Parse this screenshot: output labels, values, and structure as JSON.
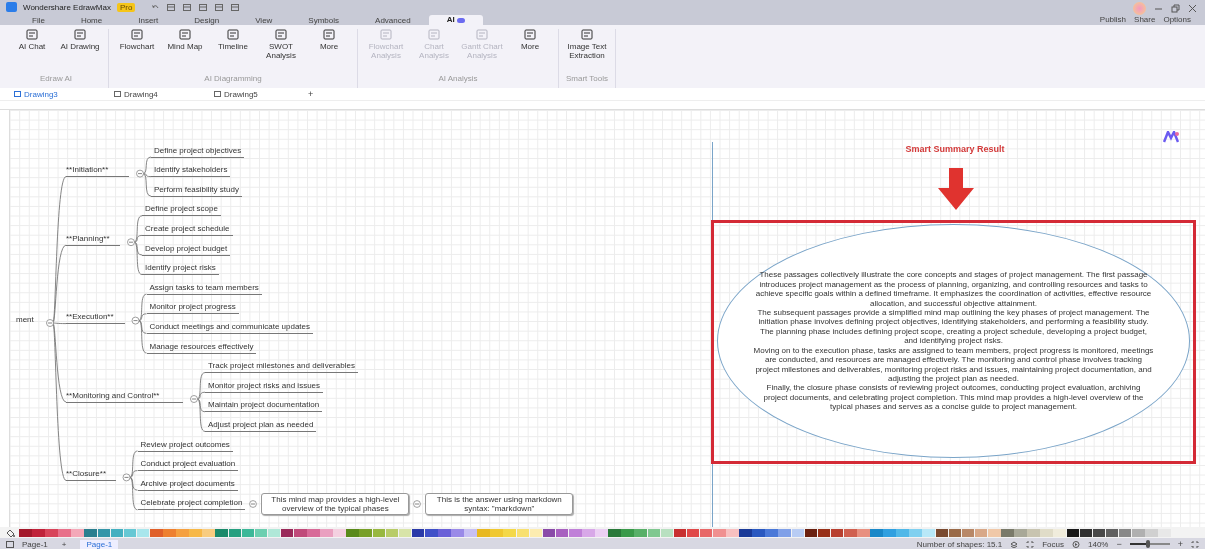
{
  "app": {
    "title": "Wondershare EdrawMax",
    "badge": "Pro"
  },
  "menu_tabs": [
    {
      "label": "File",
      "selected": false
    },
    {
      "label": "Home",
      "selected": false
    },
    {
      "label": "Insert",
      "selected": false
    },
    {
      "label": "Design",
      "selected": false
    },
    {
      "label": "View",
      "selected": false
    },
    {
      "label": "Symbols",
      "selected": false
    },
    {
      "label": "Advanced",
      "selected": false
    },
    {
      "label": "AI",
      "selected": true
    }
  ],
  "account_actions": [
    "Publish",
    "Share",
    "Options"
  ],
  "ribbon_groups": [
    {
      "title": "Edraw AI",
      "buttons": [
        {
          "label": "AI Chat",
          "disabled": false
        },
        {
          "label": "AI Drawing",
          "disabled": false
        }
      ]
    },
    {
      "title": "AI Diagramming",
      "buttons": [
        {
          "label": "Flowchart",
          "disabled": false
        },
        {
          "label": "Mind Map",
          "disabled": false
        },
        {
          "label": "Timeline",
          "disabled": false
        },
        {
          "label": "SWOT Analysis",
          "disabled": false
        },
        {
          "label": "More",
          "disabled": false
        }
      ]
    },
    {
      "title": "AI Analysis",
      "buttons": [
        {
          "label": "Flowchart Analysis",
          "disabled": true
        },
        {
          "label": "Chart Analysis",
          "disabled": true
        },
        {
          "label": "Gantt Chart Analysis",
          "disabled": true
        },
        {
          "label": "More",
          "disabled": false
        }
      ]
    },
    {
      "title": "Smart Tools",
      "buttons": [
        {
          "label": "Image Text Extraction",
          "disabled": false
        }
      ]
    }
  ],
  "document_tabs": [
    {
      "label": "Drawing3",
      "selected": true
    },
    {
      "label": "Drawing4",
      "selected": false
    },
    {
      "label": "Drawing5",
      "selected": false
    }
  ],
  "add_tab": "+",
  "mind_map": {
    "label": "ment",
    "children": [
      {
        "label": "**Initiation**",
        "children": [
          {
            "label": "Define project objectives"
          },
          {
            "label": "Identify stakeholders"
          },
          {
            "label": "Perform feasibility study"
          }
        ]
      },
      {
        "label": "**Planning**",
        "children": [
          {
            "label": "Define project scope"
          },
          {
            "label": "Create project schedule"
          },
          {
            "label": "Develop project budget"
          },
          {
            "label": "Identify project risks"
          }
        ]
      },
      {
        "label": "**Execution**",
        "children": [
          {
            "label": "Assign tasks to team members"
          },
          {
            "label": "Monitor project progress"
          },
          {
            "label": "Conduct meetings and communicate updates"
          },
          {
            "label": "Manage resources effectively"
          }
        ]
      },
      {
        "label": "**Monitoring and Control**",
        "children": [
          {
            "label": "Track project milestones and deliverables"
          },
          {
            "label": "Monitor project risks and issues"
          },
          {
            "label": "Maintain project documentation"
          },
          {
            "label": "Adjust project plan as needed"
          }
        ]
      },
      {
        "label": "**Closure**",
        "children": [
          {
            "label": "Review project outcomes"
          },
          {
            "label": "Conduct project evaluation"
          },
          {
            "label": "Archive project documents"
          },
          {
            "label": "Celebrate project completion",
            "children": [
              {
                "label": "This mind map provides a high-level overview of the typical phases",
                "children": [
                  {
                    "label": "This is the answer using markdown syntax: \"markdown\""
                  }
                ]
              }
            ]
          }
        ]
      }
    ]
  },
  "summary": {
    "title": "Smart Summary Result",
    "paragraphs": [
      "These passages collectively illustrate the core concepts and stages of project management. The first passage introduces project management as the process of planning, organizing, and controlling resources and tasks to achieve specific goals within a defined timeframe. It emphasizes the coordination of activities, effective resource allocation, and successful objective attainment.",
      "The subsequent passages provide a simplified mind map outlining the key phases of project management. The initiation phase involves defining project objectives, identifying stakeholders, and performing a feasibility study. The planning phase includes defining project scope, creating a project schedule, developing a project budget, and identifying project risks.",
      "Moving on to the execution phase, tasks are assigned to team members, project progress is monitored, meetings are conducted, and resources are managed effectively. The monitoring and control phase involves tracking project milestones and deliverables, monitoring project risks and issues, maintaining project documentation, and adjusting the project plan as needed.",
      "Finally, the closure phase consists of reviewing project outcomes, conducting project evaluation, archiving project documents, and celebrating project completion. This mind map provides a high-level overview of the typical phases and serves as a concise guide to project management."
    ]
  },
  "palette": [
    {
      "color": "#a3182b"
    },
    {
      "color": "#c0223a"
    },
    {
      "color": "#d8445a"
    },
    {
      "color": "#e8708a"
    },
    {
      "color": "#f4a8b8"
    },
    {
      "color": "#2a7f8f"
    },
    {
      "color": "#3596a8"
    },
    {
      "color": "#44b0c0"
    },
    {
      "color": "#66c8d4"
    },
    {
      "color": "#a8e6ec"
    },
    {
      "color": "#e0602a"
    },
    {
      "color": "#ee8030"
    },
    {
      "color": "#f5a040"
    },
    {
      "color": "#f7b848"
    },
    {
      "color": "#f8cc80"
    },
    {
      "color": "#1a8a6a"
    },
    {
      "color": "#26a080"
    },
    {
      "color": "#3cb898"
    },
    {
      "color": "#6ccfb0"
    },
    {
      "color": "#b0e8d8"
    },
    {
      "color": "#9a2a5a"
    },
    {
      "color": "#c04a7a"
    },
    {
      "color": "#d86a98"
    },
    {
      "color": "#eaa0c0"
    },
    {
      "color": "#f4d0e0"
    },
    {
      "color": "#5a8a1a"
    },
    {
      "color": "#78a028"
    },
    {
      "color": "#98b840"
    },
    {
      "color": "#b8cc68"
    },
    {
      "color": "#d8e4a8"
    },
    {
      "color": "#2a3aa8"
    },
    {
      "color": "#4050c8"
    },
    {
      "color": "#6a60d8"
    },
    {
      "color": "#9a8ae8"
    },
    {
      "color": "#c8c0f4"
    },
    {
      "color": "#e8b820"
    },
    {
      "color": "#f0c830"
    },
    {
      "color": "#f4d848"
    },
    {
      "color": "#f8e070"
    },
    {
      "color": "#fcecb0"
    },
    {
      "color": "#8a4aa8"
    },
    {
      "color": "#a860c0"
    },
    {
      "color": "#c080d8"
    },
    {
      "color": "#d8a8e8"
    },
    {
      "color": "#ecd0f4"
    },
    {
      "color": "#2a7a3a"
    },
    {
      "color": "#3a9a4a"
    },
    {
      "color": "#58b068"
    },
    {
      "color": "#80c890"
    },
    {
      "color": "#b8e0c0"
    },
    {
      "color": "#c83030"
    },
    {
      "color": "#e04848"
    },
    {
      "color": "#e86868"
    },
    {
      "color": "#f09090"
    },
    {
      "color": "#f8c0c0"
    },
    {
      "color": "#1a3a98"
    },
    {
      "color": "#2a58c0"
    },
    {
      "color": "#4a78d8"
    },
    {
      "color": "#80a0e8"
    },
    {
      "color": "#b8ccf4"
    },
    {
      "color": "#6a2010"
    },
    {
      "color": "#983018"
    },
    {
      "color": "#b84030"
    },
    {
      "color": "#d06050"
    },
    {
      "color": "#e89080"
    },
    {
      "color": "#1a88c8"
    },
    {
      "color": "#30a0e0"
    },
    {
      "color": "#50b8e8"
    },
    {
      "color": "#80d0f0"
    },
    {
      "color": "#b8e8f8"
    },
    {
      "color": "#7a4a30"
    },
    {
      "color": "#9a6a48"
    },
    {
      "color": "#b88868"
    },
    {
      "color": "#d8a888"
    },
    {
      "color": "#f0c8a8"
    },
    {
      "color": "#7a7a6a"
    },
    {
      "color": "#a8a898"
    },
    {
      "color": "#c8c4b0"
    },
    {
      "color": "#e0dcc8"
    },
    {
      "color": "#f0ecdc"
    },
    {
      "color": "#181818"
    },
    {
      "color": "#303030"
    },
    {
      "color": "#484848"
    },
    {
      "color": "#606060"
    },
    {
      "color": "#888888"
    },
    {
      "color": "#b0b0b0"
    },
    {
      "color": "#d0d0d0"
    },
    {
      "color": "#e8e8e8"
    }
  ],
  "status_bar": {
    "page_tab": "Page-1",
    "add_page": "+",
    "pages": [
      {
        "label": "Page-1",
        "selected": true
      }
    ],
    "shapes": "Number of shapes: 15.1",
    "focus": "Focus",
    "zoom": "140%",
    "zoom_out": "−",
    "zoom_slider": {
      "level": 0.45
    },
    "zoom_in": "+"
  }
}
